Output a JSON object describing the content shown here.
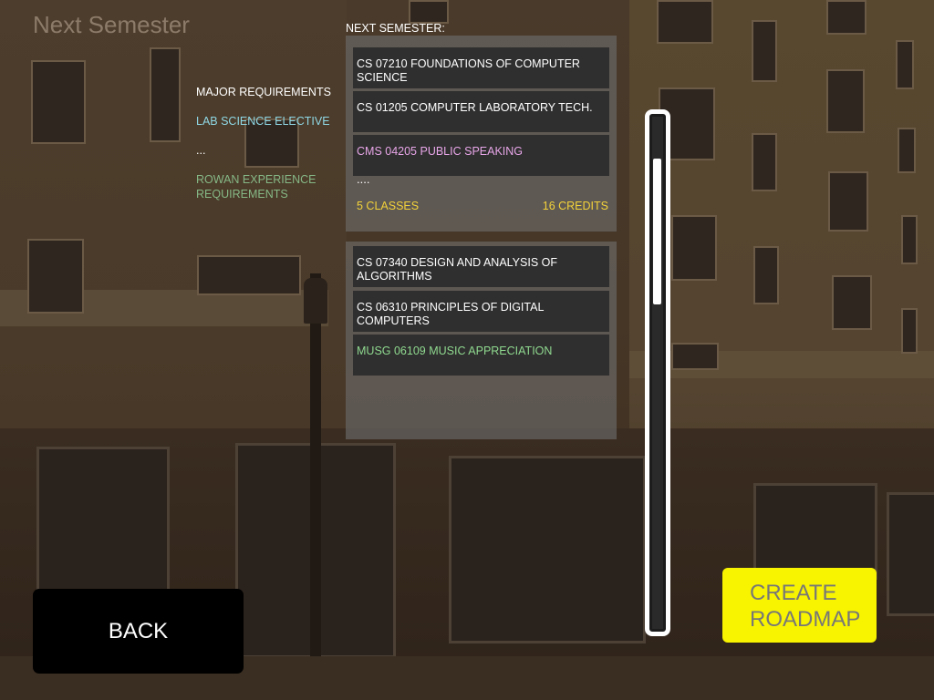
{
  "header": {
    "title": "Next Semester"
  },
  "requirements": {
    "items": [
      {
        "label": "MAJOR REQUIREMENTS"
      },
      {
        "label": "LAB SCIENCE ELECTIVE"
      },
      {
        "label": "..."
      },
      {
        "label": "ROWAN EXPERIENCE REQUIREMENTS"
      }
    ]
  },
  "next_semester": {
    "label": "NEXT SEMESTER:",
    "semesters": [
      {
        "courses": [
          {
            "name": "CS 07210 FOUNDATIONS OF COMPUTER SCIENCE",
            "color": "#ffffff"
          },
          {
            "name": "CS 01205 COMPUTER LABORATORY TECH.",
            "color": "#ffffff"
          },
          {
            "name": "CMS 04205 PUBLIC SPEAKING",
            "color": "#e8a6e8"
          }
        ],
        "more": "....",
        "classes": "5 CLASSES",
        "credits": "16 CREDITS"
      },
      {
        "courses": [
          {
            "name": "CS 07340 DESIGN AND ANALYSIS OF ALGORITHMS",
            "color": "#ffffff"
          },
          {
            "name": "CS 06310 PRINCIPLES OF DIGITAL COMPUTERS",
            "color": "#ffffff"
          },
          {
            "name": "MUSG 06109 MUSIC APPRECIATION",
            "color": "#8fd88f"
          }
        ]
      }
    ]
  },
  "scrollbar": {
    "position": 0.09
  },
  "buttons": {
    "back": "BACK",
    "create_line1": "CREATE",
    "create_line2": "ROADMAP"
  },
  "colors": {
    "accent_yellow": "#f8f400",
    "lab_science": "#8fd8e6",
    "rowan_experience": "#86b886",
    "pink_course": "#e8a6e8",
    "green_course": "#8fd88f",
    "summary_text": "#f2d23a"
  }
}
